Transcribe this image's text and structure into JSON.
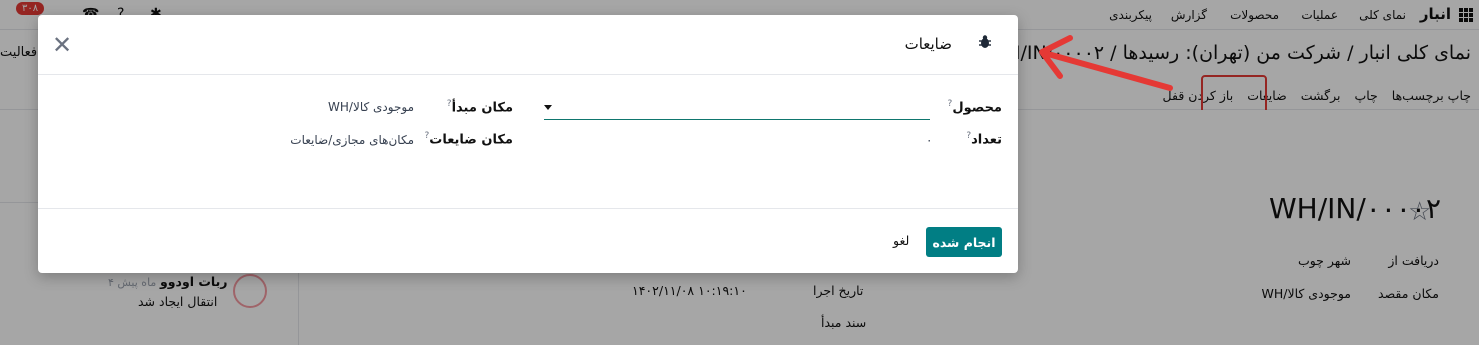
{
  "topbar": {
    "brand": "انبار",
    "menu": [
      "نمای کلی",
      "عملیات",
      "محصولات",
      "گزارش",
      "پیکربندی"
    ],
    "badge": "۳۰۸"
  },
  "controlbar": {
    "breadcrumb": "نمای کلی انبار / شرکت من (تهران): رسیدها / WH/IN/۰۰۰۰۲",
    "activity": "فعالیت",
    "actions": [
      "چاپ برچسب‌ها",
      "چاپ",
      "برگشت",
      "ضایعات",
      "باز کردن قفل"
    ]
  },
  "form": {
    "title": "WH/IN/۰۰۰۰۲",
    "receive_from_label": "دریافت از",
    "receive_from_value": "شهر چوب",
    "dest_location_label": "مکان مقصد",
    "dest_location_value": "WH/موجودی کالا",
    "scheduled_date_label": "تاریخ اجرا",
    "scheduled_date_value": "۱۴۰۲/۱۱/۰۸ ۱۰:۱۹:۱۰",
    "source_doc_label": "سند مبدأ"
  },
  "chatter": {
    "author": "ربات اودوو",
    "time": "۴ ماه پیش",
    "message": "انتقال ایجاد شد"
  },
  "modal": {
    "title": "ضایعات",
    "product_label": "محصول",
    "product_value": "",
    "quantity_label": "تعداد",
    "quantity_value": "۰",
    "source_location_label": "مکان مبدأ",
    "source_location_value": "WH/موجودی کالا",
    "scrap_location_label": "مکان ضایعات",
    "scrap_location_value": "مکان‌های مجازی/ضایعات",
    "done_label": "انجام شده",
    "cancel_label": "لغو"
  },
  "colors": {
    "primary": "#017e84",
    "highlight": "#e53935"
  }
}
